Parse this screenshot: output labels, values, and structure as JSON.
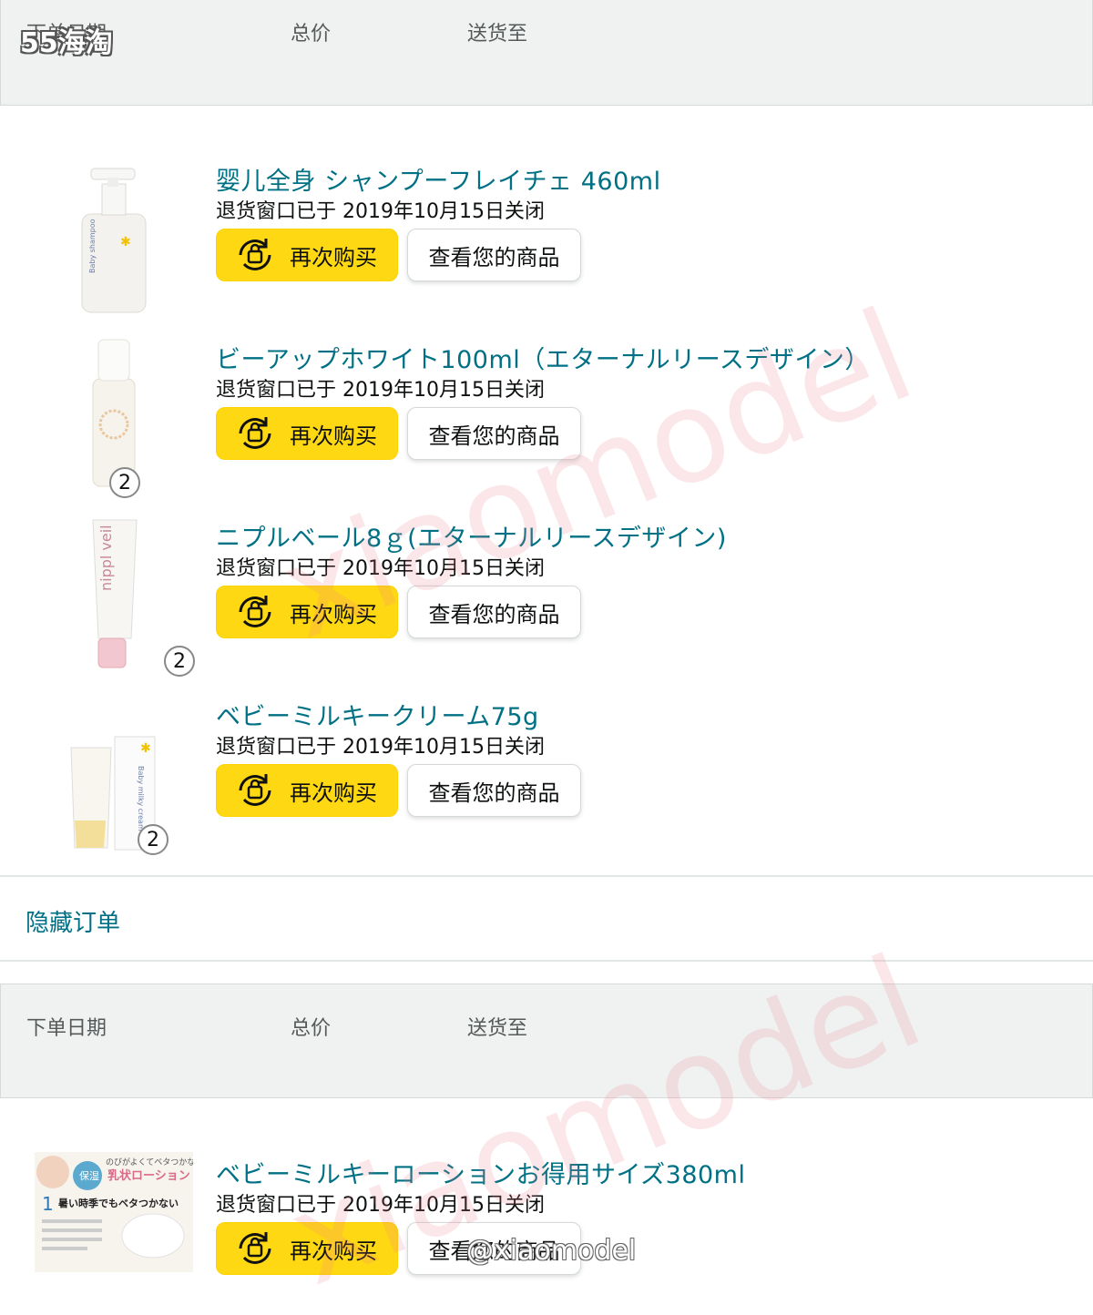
{
  "overlay": {
    "site_logo": "55海淘",
    "watermark": "xiaomodel",
    "credit": "@xiaomodel"
  },
  "orders": [
    {
      "header": {
        "col_date": "下单日期",
        "col_total": "总价",
        "col_ship": "送货至"
      },
      "items": [
        {
          "title": "婴儿全身 シャンプーフレイチェ 460ml",
          "status": "退货窗口已于 2019年10月15日关闭",
          "qty": ""
        },
        {
          "title": "ビーアップホワイト100ml（エターナルリースデザイン）",
          "status": "退货窗口已于 2019年10月15日关闭",
          "qty": "2"
        },
        {
          "title": "ニプルベール8ｇ(エターナルリースデザイン)",
          "status": "退货窗口已于 2019年10月15日关闭",
          "qty": "2"
        },
        {
          "title": "ベビーミルキークリーム75g",
          "status": "退货窗口已于 2019年10月15日关闭",
          "qty": "2"
        }
      ],
      "hide_order": "隐藏订单"
    },
    {
      "header": {
        "col_date": "下单日期",
        "col_total": "总价",
        "col_ship": "送货至"
      },
      "items": [
        {
          "title": "ベビーミルキーローションお得用サイズ380ml",
          "status": "退货窗口已于 2019年10月15日关闭",
          "qty": ""
        }
      ]
    }
  ],
  "buttons": {
    "buy_again": "再次购买",
    "view_item": "查看您的商品"
  },
  "product_image_text": {
    "lotion_banner_1": "のびがよくてベタつかない",
    "lotion_banner_2": "乳状ローション",
    "lotion_badge": "保湿",
    "lotion_point": "暑い時季でもベタつかない"
  },
  "colors": {
    "link": "#007185",
    "buy_button": "#ffd814",
    "header_bg": "#f0f2f2"
  }
}
